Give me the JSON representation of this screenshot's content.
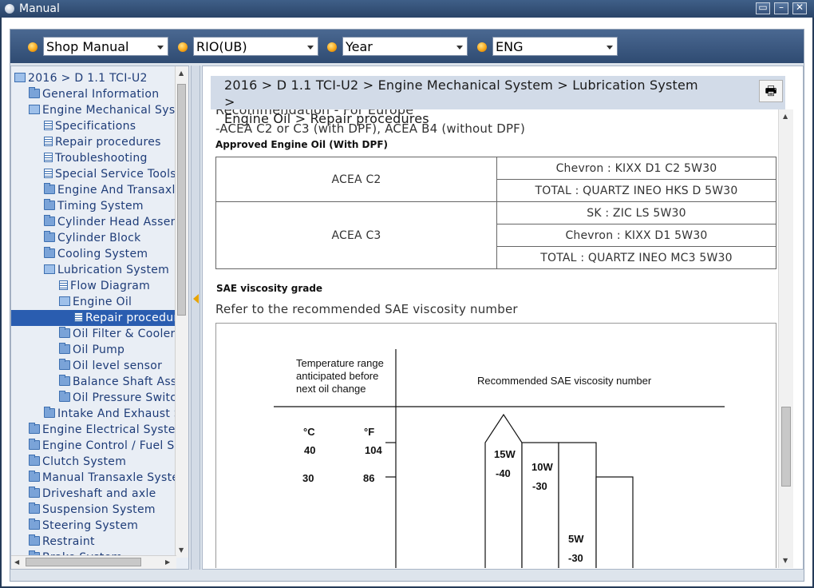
{
  "window": {
    "title": "Manual",
    "buttons": [
      "restore",
      "minimize",
      "close"
    ]
  },
  "toolbar": {
    "selects": [
      {
        "value": "Shop Manual"
      },
      {
        "value": "RIO(UB)"
      },
      {
        "value": "Year"
      },
      {
        "value": "ENG"
      }
    ]
  },
  "tree": {
    "items": [
      {
        "label": "2016 > D 1.1 TCI-U2",
        "icon": "folder-open-icon"
      },
      {
        "label": "General Information",
        "icon": "folder-icon"
      },
      {
        "label": "Engine Mechanical System",
        "icon": "folder-open-icon"
      },
      {
        "label": "Specifications",
        "icon": "document-icon"
      },
      {
        "label": "Repair procedures",
        "icon": "document-icon"
      },
      {
        "label": "Troubleshooting",
        "icon": "document-icon"
      },
      {
        "label": "Special Service Tools",
        "icon": "document-icon"
      },
      {
        "label": "Engine And Transaxle",
        "icon": "folder-icon"
      },
      {
        "label": "Timing System",
        "icon": "folder-icon"
      },
      {
        "label": "Cylinder Head Assembly",
        "icon": "folder-icon"
      },
      {
        "label": "Cylinder Block",
        "icon": "folder-icon"
      },
      {
        "label": "Cooling System",
        "icon": "folder-icon"
      },
      {
        "label": "Lubrication System",
        "icon": "folder-open-icon"
      },
      {
        "label": "Flow Diagram",
        "icon": "document-icon"
      },
      {
        "label": "Engine Oil",
        "icon": "folder-open-icon"
      },
      {
        "label": "Repair procedures",
        "icon": "document-icon",
        "selected": true
      },
      {
        "label": "Oil Filter & Cooler",
        "icon": "folder-icon"
      },
      {
        "label": "Oil Pump",
        "icon": "folder-icon"
      },
      {
        "label": "Oil level sensor",
        "icon": "folder-icon"
      },
      {
        "label": "Balance Shaft Assembly",
        "icon": "folder-icon"
      },
      {
        "label": "Oil Pressure Switch",
        "icon": "folder-icon"
      },
      {
        "label": "Intake And Exhaust System",
        "icon": "folder-icon"
      },
      {
        "label": "Engine Electrical System",
        "icon": "folder-icon"
      },
      {
        "label": "Engine Control / Fuel System",
        "icon": "folder-icon"
      },
      {
        "label": "Clutch System",
        "icon": "folder-icon"
      },
      {
        "label": "Manual Transaxle System",
        "icon": "folder-icon"
      },
      {
        "label": "Driveshaft and axle",
        "icon": "folder-icon"
      },
      {
        "label": "Suspension System",
        "icon": "folder-icon"
      },
      {
        "label": "Steering System",
        "icon": "folder-icon"
      },
      {
        "label": "Restraint",
        "icon": "folder-icon"
      },
      {
        "label": "Brake System",
        "icon": "folder-icon"
      }
    ]
  },
  "content": {
    "breadcrumb_line1": "2016 > D 1.1 TCI-U2 > Engine Mechanical System > Lubrication System >",
    "breadcrumb_line2": "Engine Oil > Repair procedures",
    "print_icon": "printer-icon",
    "heading_partial": "Recommendation - For Europe",
    "acea_line": "-ACEA C2 or C3 (with DPF), ACEA B4 (without DPF)",
    "approved_title": "Approved Engine Oil (With DPF)",
    "oil_table": [
      {
        "spec": "ACEA C2",
        "oils": [
          "Chevron : KIXX D1 C2 5W30",
          "TOTAL : QUARTZ INEO HKS D 5W30"
        ]
      },
      {
        "spec": "ACEA C3",
        "oils": [
          "SK : ZIC LS 5W30",
          "Chevron : KIXX D1 5W30",
          "TOTAL : QUARTZ INEO MC3 5W30"
        ]
      }
    ],
    "sae_title": "SAE viscosity grade",
    "sae_text": "Refer to the recommended SAE viscosity number",
    "diagram": {
      "temp_header": [
        "Temperature range",
        "anticipated before",
        "next oil change"
      ],
      "recommended_header": "Recommended SAE viscosity number",
      "unit_c": "°C",
      "unit_f": "°F",
      "celsius_ticks": [
        "40",
        "30"
      ],
      "fahrenheit_ticks": [
        "104",
        "86"
      ],
      "grades": [
        {
          "line1": "15W",
          "line2": "-40"
        },
        {
          "line1": "10W",
          "line2": "-30"
        },
        {
          "line1": "5W",
          "line2": "-30"
        }
      ]
    }
  }
}
